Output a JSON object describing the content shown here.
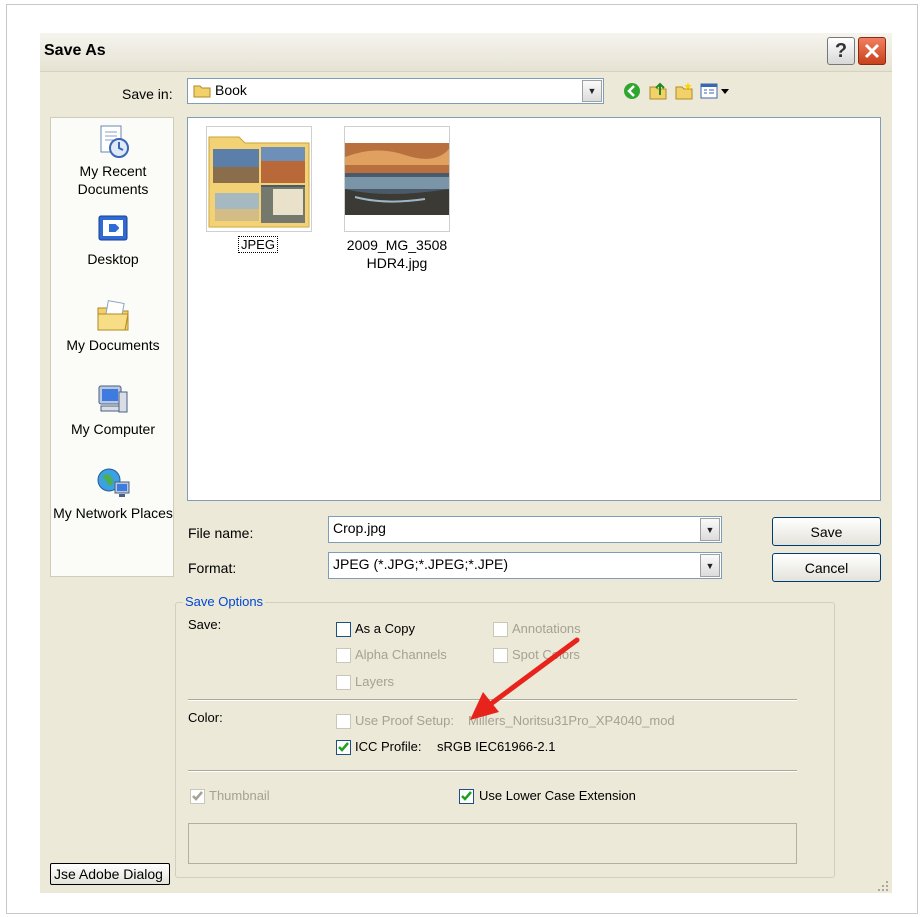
{
  "window": {
    "title": "Save As"
  },
  "save_in": {
    "label": "Save in:",
    "value": "Book"
  },
  "places": [
    {
      "label": "My Recent Documents",
      "icon": "recent-documents-icon"
    },
    {
      "label": "Desktop",
      "icon": "desktop-icon"
    },
    {
      "label": "My Documents",
      "icon": "my-documents-icon"
    },
    {
      "label": "My Computer",
      "icon": "my-computer-icon"
    },
    {
      "label": "My Network Places",
      "icon": "network-places-icon"
    }
  ],
  "files": [
    {
      "name": "JPEG",
      "type": "folder"
    },
    {
      "name": "2009_MG_3508 HDR4.jpg",
      "type": "image"
    }
  ],
  "file_name": {
    "label": "File name:",
    "value": "Crop.jpg"
  },
  "format": {
    "label": "Format:",
    "value": "JPEG (*.JPG;*.JPEG;*.JPE)"
  },
  "buttons": {
    "save": "Save",
    "cancel": "Cancel",
    "adobe": "Jse Adobe Dialog"
  },
  "save_options": {
    "legend": "Save Options",
    "save_label": "Save:",
    "as_copy": "As a Copy",
    "annotations": "Annotations",
    "alpha_channels": "Alpha Channels",
    "spot_colors": "Spot Colors",
    "layers": "Layers",
    "color_label": "Color:",
    "use_proof_setup": "Use Proof Setup:",
    "proof_profile": "Millers_Noritsu31Pro_XP4040_mod",
    "icc_profile": "ICC Profile:",
    "icc_value": "sRGB IEC61966-2.1",
    "thumbnail": "Thumbnail",
    "lower_case": "Use Lower Case Extension"
  },
  "colors": {
    "accent": "#0046d5",
    "arrow": "#e8231b",
    "close": "#c8401c"
  }
}
